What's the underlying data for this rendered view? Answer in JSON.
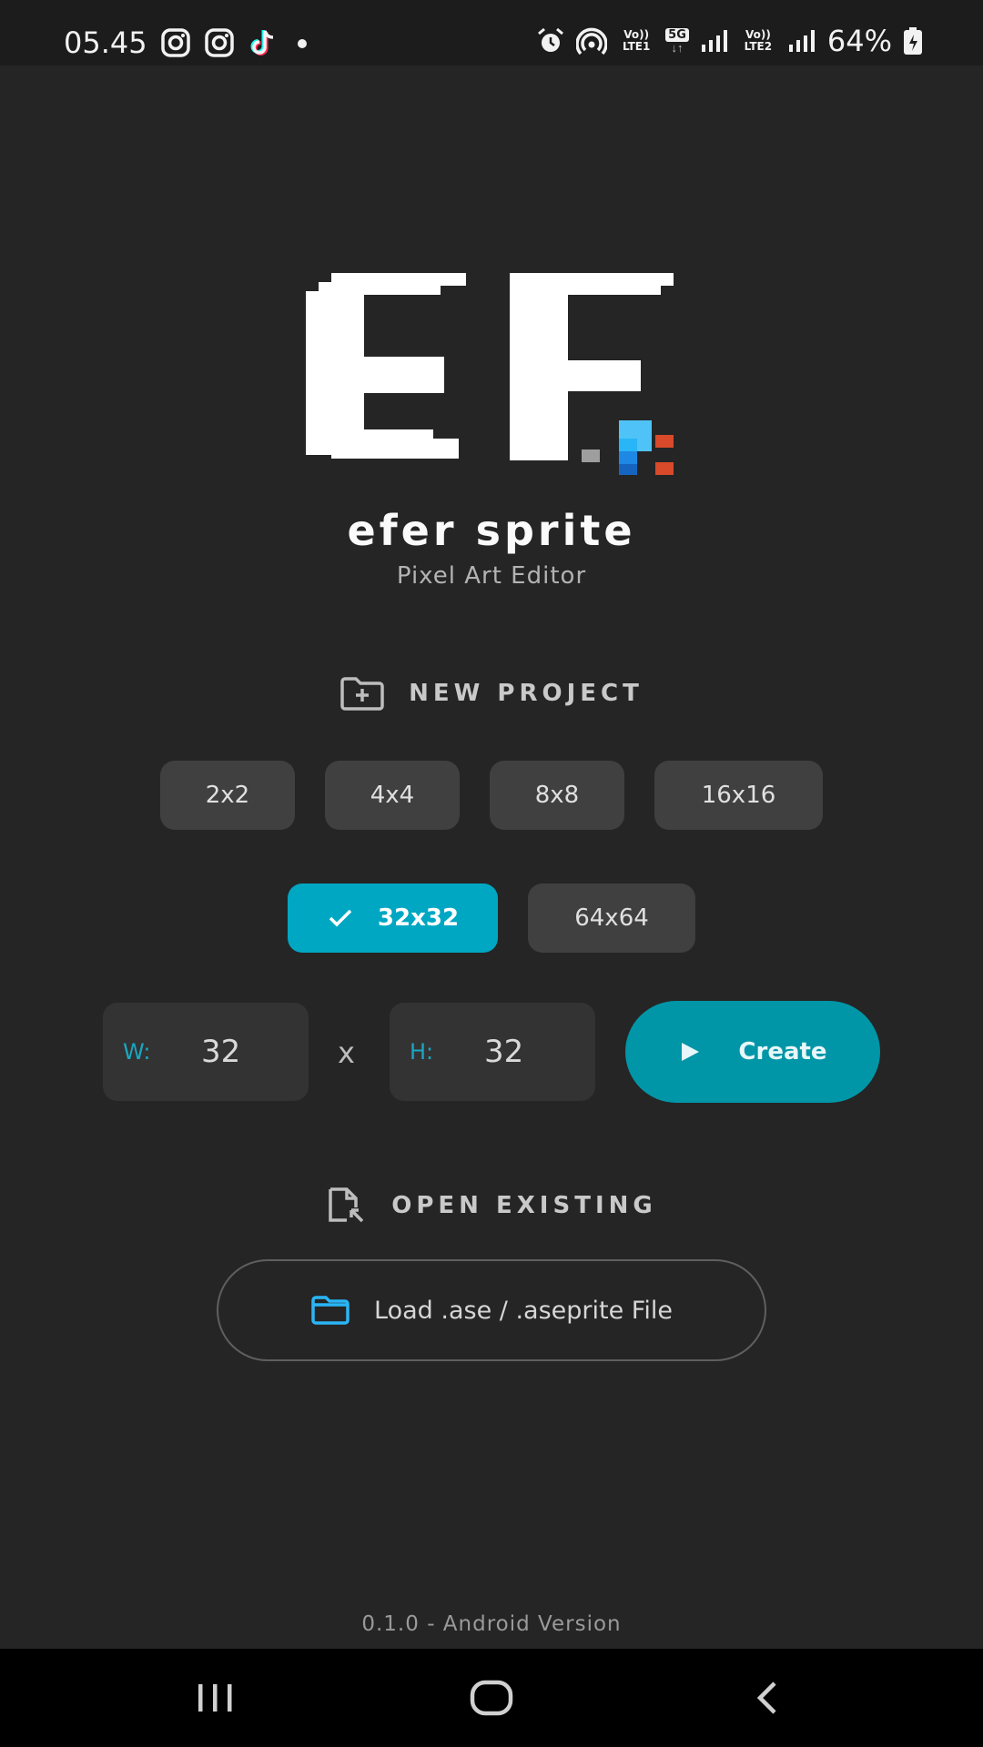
{
  "status_bar": {
    "time": "05.45",
    "battery": "64%",
    "sim1_label": "Vo)) LTE1",
    "sim2_label": "Vo)) LTE2",
    "network": "5G",
    "left_icons": [
      "instagram-icon",
      "instagram-icon",
      "tiktok-icon",
      "dot-icon"
    ],
    "right_icons": [
      "alarm-icon",
      "hotspot-icon",
      "signal-icon",
      "signal-icon",
      "battery-icon"
    ]
  },
  "app": {
    "name": "efer sprite",
    "subtitle": "Pixel Art Editor",
    "version": "0.1.0 - Android Version"
  },
  "new_project": {
    "title": "NEW PROJECT",
    "presets": [
      "2x2",
      "4x4",
      "8x8",
      "16x16",
      "32x32",
      "64x64"
    ],
    "selected": "32x32",
    "width_prefix": "W:",
    "width_value": "32",
    "height_prefix": "H:",
    "height_value": "32",
    "separator": "x",
    "create_label": "Create"
  },
  "open_existing": {
    "title": "OPEN EXISTING",
    "load_label": "Load .ase / .aseprite File"
  },
  "colors": {
    "background": "#252525",
    "accent": "#00a7c3",
    "create_button": "#0096a7",
    "chip": "#404040",
    "field": "#333333",
    "logo_blue": "#29b6f6",
    "logo_red": "#d84a2a"
  }
}
